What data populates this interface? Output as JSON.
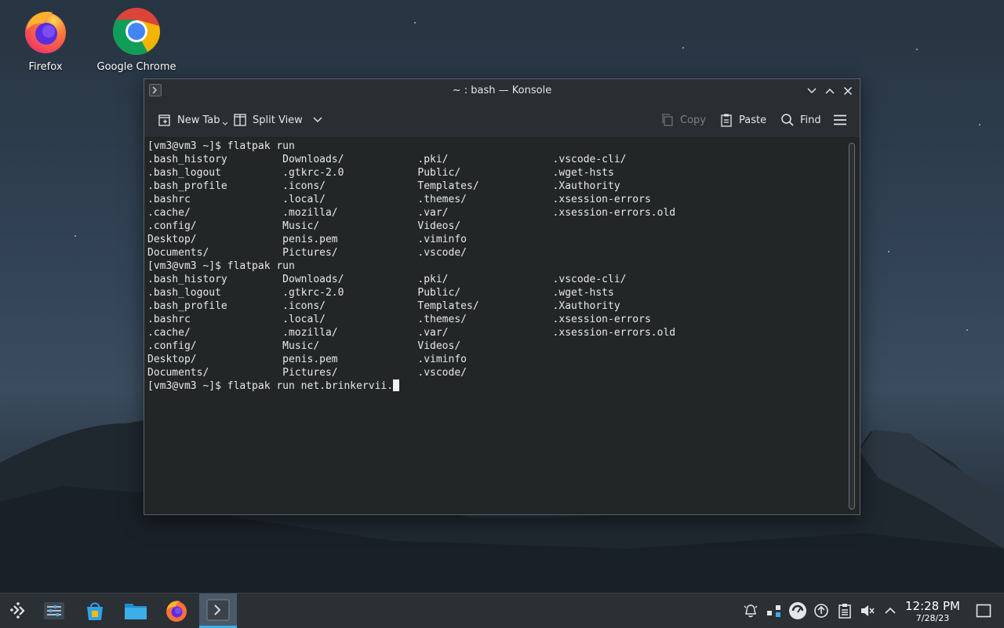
{
  "desktop": {
    "icons": [
      {
        "label": "Firefox",
        "icon": "firefox-icon"
      },
      {
        "label": "Google Chrome",
        "icon": "chrome-icon"
      }
    ]
  },
  "window": {
    "title": "~ : bash — Konsole",
    "toolbar": {
      "new_tab": "New Tab",
      "split_view": "Split View",
      "copy": "Copy",
      "paste": "Paste",
      "find": "Find"
    },
    "terminal": {
      "lines": [
        "[vm3@vm3 ~]$ flatpak run",
        ".bash_history         Downloads/            .pki/                 .vscode-cli/",
        ".bash_logout          .gtkrc-2.0            Public/               .wget-hsts",
        ".bash_profile         .icons/               Templates/            .Xauthority",
        ".bashrc               .local/               .themes/              .xsession-errors",
        ".cache/               .mozilla/             .var/                 .xsession-errors.old",
        ".config/              Music/                Videos/",
        "Desktop/              penis.pem             .viminfo",
        "Documents/            Pictures/             .vscode/",
        "[vm3@vm3 ~]$ flatpak run",
        ".bash_history         Downloads/            .pki/                 .vscode-cli/",
        ".bash_logout          .gtkrc-2.0            Public/               .wget-hsts",
        ".bash_profile         .icons/               Templates/            .Xauthority",
        ".bashrc               .local/               .themes/              .xsession-errors",
        ".cache/               .mozilla/             .var/                 .xsession-errors.old",
        ".config/              Music/                Videos/",
        "Desktop/              penis.pem             .viminfo",
        "Documents/            Pictures/             .vscode/"
      ],
      "prompt_line": "[vm3@vm3 ~]$ flatpak run net.brinkervii."
    }
  },
  "taskbar": {
    "launchers": [
      "app-launcher-icon",
      "system-settings-icon",
      "discover-store-icon",
      "dolphin-files-icon",
      "firefox-icon",
      "konsole-icon"
    ],
    "tray": [
      "notifications-icon",
      "network-icon",
      "updates-icon",
      "clipboard-icon",
      "volume-muted-icon",
      "expand-tray-icon"
    ],
    "clock": {
      "time": "12:28 PM",
      "date": "7/28/23"
    }
  }
}
